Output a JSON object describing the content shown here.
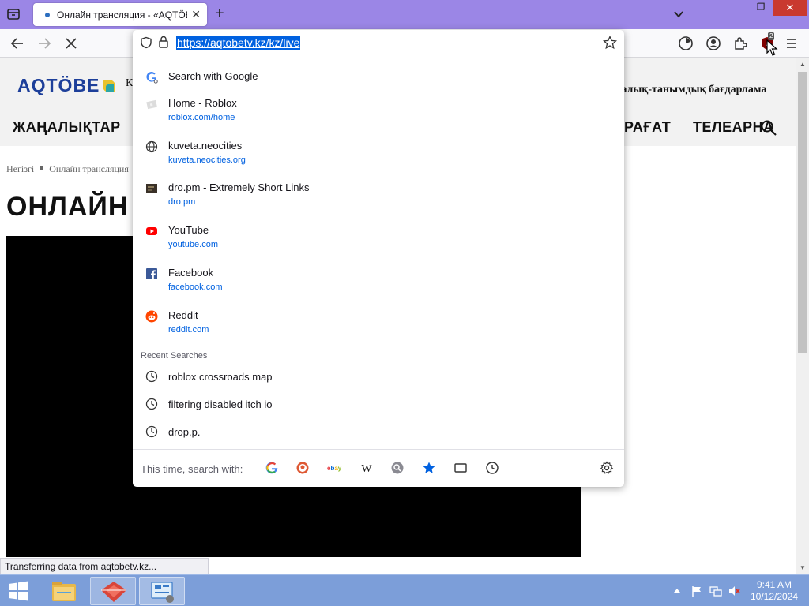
{
  "browser": {
    "tab_title": "Онлайн трансляция - «AQTÖBE",
    "tab_close": "✕",
    "new_tab": "+",
    "window_min": "—",
    "window_max": "❐",
    "window_close": "✕",
    "extension_badge_count": "2"
  },
  "url_bar": {
    "url": "https://aqtobetv.kz/kz/live"
  },
  "suggestions": [
    {
      "title": "Search with Google",
      "url": "",
      "icon": "google-icon"
    },
    {
      "title": "Home - Roblox",
      "url": "roblox.com/home",
      "icon": "roblox-favicon"
    },
    {
      "title": "kuveta.neocities",
      "url": "kuveta.neocities.org",
      "icon": "globe-icon"
    },
    {
      "title": "dro.pm - Extremely Short Links",
      "url": "dro.pm",
      "icon": "dro-favicon"
    },
    {
      "title": "YouTube",
      "url": "youtube.com",
      "icon": "youtube-icon"
    },
    {
      "title": "Facebook",
      "url": "facebook.com",
      "icon": "facebook-icon"
    },
    {
      "title": "Reddit",
      "url": "reddit.com",
      "icon": "reddit-icon"
    }
  ],
  "recent_searches": {
    "header": "Recent Searches",
    "items": [
      "roblox crossroads map",
      "filtering disabled itch io",
      "drop.p."
    ]
  },
  "search_with": {
    "label": "This time, search with:",
    "engines": [
      "google-icon",
      "duckduckgo-icon",
      "ebay-icon",
      "wikipedia-icon",
      "search-icon",
      "bookmarks-star-icon",
      "tabs-icon",
      "history-icon"
    ]
  },
  "site": {
    "logo_text": "AQTÖBE",
    "header_k": "К",
    "program_text": "ғалық-танымдық бағдарлама",
    "menu_news": "ЖАҢАЛЫҚТАР",
    "menu_ragat": "РАҒАТ",
    "menu_telearna": "ТЕЛЕАРНА",
    "breadcrumb_home": "Негізгі",
    "breadcrumb_current": "Онлайн трансляция",
    "page_heading": "ОНЛАЙН"
  },
  "status_bar": "Transferring data from aqtobetv.kz...",
  "taskbar": {
    "time": "9:41 AM",
    "date": "10/12/2024"
  },
  "colors": {
    "tabstrip": "#9b86e6",
    "url_highlight": "#0061e0",
    "link": "#0061e0",
    "taskbar": "#7c9ed9",
    "logo": "#1d3f9a"
  }
}
